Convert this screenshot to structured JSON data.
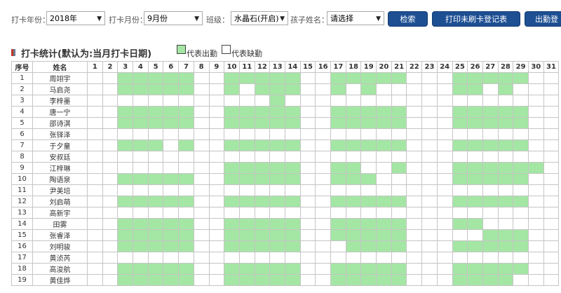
{
  "filters": {
    "year_label": "打卡年份：",
    "year_value": "2018年",
    "month_label": "打卡月份：",
    "month_value": "9月份",
    "class_label": "班级：",
    "class_value": "水晶石(开启)",
    "child_label": "孩子姓名：",
    "child_value": "请选择",
    "search_button": "检索",
    "print_button": "打印未刷卡登记表",
    "attendance_button": "出勤登"
  },
  "section": {
    "title": "打卡统计(默认为:当月打卡日期)",
    "legend_present": "代表出勤",
    "legend_absent": "代表缺勤"
  },
  "colors": {
    "present": "#a4e6a4",
    "absent": "#ffffff",
    "accent": "#1e4f93",
    "marker_red": "#c0392b"
  },
  "table": {
    "col_index": "序号",
    "col_name": "姓名",
    "days": [
      "1",
      "2",
      "3",
      "4",
      "5",
      "6",
      "7",
      "8",
      "9",
      "10",
      "11",
      "12",
      "13",
      "14",
      "15",
      "16",
      "17",
      "18",
      "19",
      "20",
      "21",
      "22",
      "23",
      "24",
      "25",
      "26",
      "27",
      "28",
      "29",
      "30",
      "31"
    ],
    "rows": [
      {
        "no": "1",
        "name": "周翊宇",
        "present": [
          3,
          4,
          5,
          6,
          7,
          10,
          11,
          12,
          13,
          14,
          17,
          18,
          19,
          20,
          21,
          25,
          26,
          27,
          28,
          29
        ]
      },
      {
        "no": "2",
        "name": "马启尧",
        "present": [
          3,
          4,
          5,
          6,
          7,
          10,
          12,
          13,
          14,
          17,
          19,
          25,
          26,
          28
        ]
      },
      {
        "no": "3",
        "name": "李梓墨",
        "present": [
          13
        ]
      },
      {
        "no": "4",
        "name": "唐一宁",
        "present": [
          3,
          4,
          5,
          6,
          7,
          10,
          11,
          12,
          13,
          14,
          17,
          18,
          19,
          20,
          21,
          25,
          26,
          27,
          28,
          29
        ]
      },
      {
        "no": "5",
        "name": "邵诗淇",
        "present": [
          3,
          4,
          5,
          6,
          7,
          10,
          11,
          12,
          13,
          14,
          17,
          18,
          19,
          20,
          21,
          25,
          26,
          27,
          28,
          29
        ]
      },
      {
        "no": "6",
        "name": "张铎泽",
        "present": []
      },
      {
        "no": "7",
        "name": "于夕童",
        "present": [
          3,
          4,
          5,
          7,
          10,
          11,
          12,
          13,
          14,
          17,
          18,
          19,
          20,
          21,
          25,
          26,
          27,
          28,
          29
        ]
      },
      {
        "no": "8",
        "name": "安叔廷",
        "present": []
      },
      {
        "no": "9",
        "name": "江梓琳",
        "present": [
          10,
          11,
          12,
          13,
          14,
          17,
          18,
          21,
          25,
          26,
          27,
          28,
          29,
          30
        ]
      },
      {
        "no": "10",
        "name": "陶语泉",
        "present": [
          3,
          4,
          5,
          6,
          7,
          10,
          11,
          12,
          13,
          14,
          17,
          18,
          19,
          25,
          26,
          27,
          28,
          29
        ]
      },
      {
        "no": "11",
        "name": "尹美培",
        "present": []
      },
      {
        "no": "12",
        "name": "刘启萌",
        "present": [
          3,
          4,
          5,
          6,
          7,
          10,
          11,
          12,
          13,
          14,
          17,
          18,
          19,
          20,
          21,
          25,
          26,
          27,
          28,
          29
        ]
      },
      {
        "no": "13",
        "name": "高新宇",
        "present": []
      },
      {
        "no": "14",
        "name": "田雾",
        "present": [
          3,
          4,
          5,
          6,
          7,
          10,
          11,
          12,
          13,
          14,
          17,
          18,
          19,
          20,
          21,
          25,
          26
        ]
      },
      {
        "no": "15",
        "name": "张睿泽",
        "present": [
          3,
          4,
          5,
          6,
          7,
          10,
          11,
          12,
          13,
          14,
          17,
          18,
          19,
          20,
          21,
          27,
          28,
          29
        ]
      },
      {
        "no": "16",
        "name": "刘明骏",
        "present": [
          3,
          4,
          5,
          6,
          7,
          10,
          11,
          12,
          13,
          14,
          18,
          19,
          20,
          21,
          25,
          26,
          27,
          28,
          29
        ]
      },
      {
        "no": "17",
        "name": "黄浈芮",
        "present": []
      },
      {
        "no": "18",
        "name": "高浚航",
        "present": [
          3,
          4,
          5,
          6,
          7,
          10,
          11,
          12,
          13,
          14,
          17,
          18,
          19,
          20,
          21,
          25,
          26,
          27,
          28,
          29
        ]
      },
      {
        "no": "19",
        "name": "黄佳烨",
        "present": [
          3,
          4,
          5,
          6,
          7,
          10,
          11,
          12,
          13,
          14,
          17,
          18,
          19,
          20,
          21,
          25,
          26,
          27,
          28
        ]
      }
    ]
  }
}
